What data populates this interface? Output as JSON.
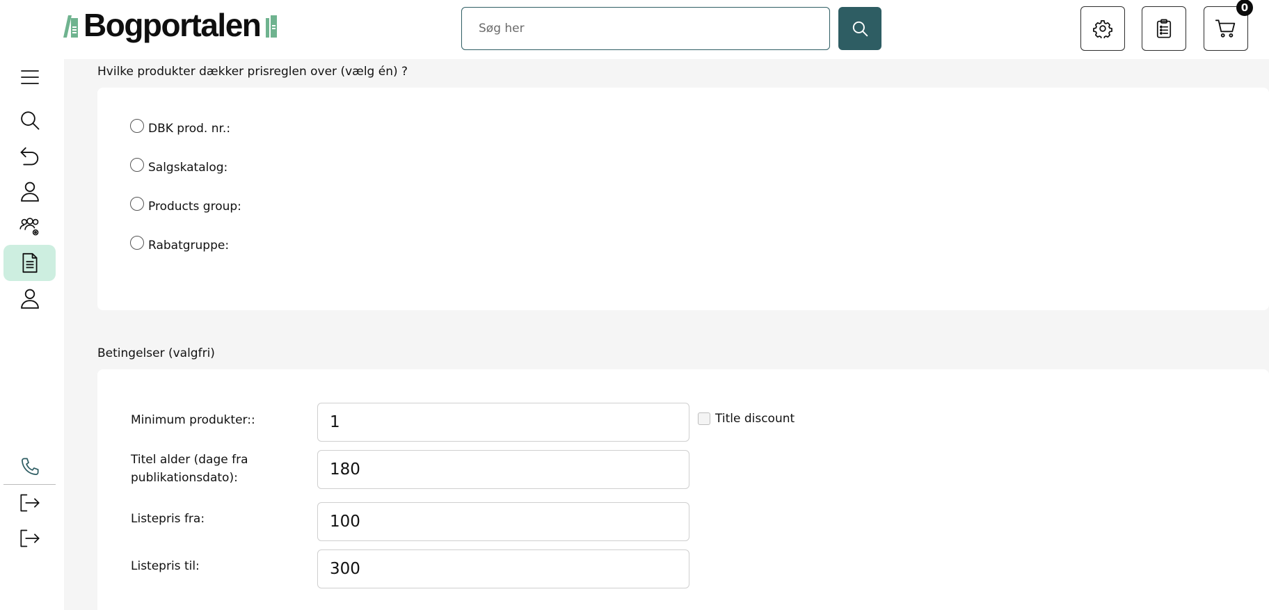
{
  "header": {
    "logo_text": "Bogportalen",
    "search_placeholder": "Søg her",
    "cart_count": "0"
  },
  "colors": {
    "brand_teal": "#2e5d63",
    "logo_green": "#6fb38f",
    "active_nav_bg": "#cdeee0",
    "main_bg": "#f5f5f5"
  },
  "sidebar": {
    "items": [
      {
        "name": "menu",
        "icon": "hamburger-icon"
      },
      {
        "name": "search",
        "icon": "search-icon"
      },
      {
        "name": "back",
        "icon": "undo-icon"
      },
      {
        "name": "user",
        "icon": "user-icon"
      },
      {
        "name": "users-settings",
        "icon": "users-gear-icon"
      },
      {
        "name": "documents",
        "icon": "document-icon",
        "active": true
      },
      {
        "name": "profile",
        "icon": "user-icon"
      },
      {
        "name": "phone",
        "icon": "phone-icon"
      },
      {
        "name": "logout-1",
        "icon": "logout-icon"
      },
      {
        "name": "logout-2",
        "icon": "logout-icon"
      }
    ]
  },
  "products_section": {
    "title": "Hvilke produkter dækker prisreglen over (vælg én) ?",
    "options": [
      {
        "label": "DBK prod. nr.:"
      },
      {
        "label": "Salgskatalog:"
      },
      {
        "label": "Products group:"
      },
      {
        "label": "Rabatgruppe:"
      }
    ]
  },
  "conditions_section": {
    "title": "Betingelser (valgfri)",
    "fields": [
      {
        "label": "Minimum produkter::",
        "value": "1"
      },
      {
        "label_line1": "Titel alder (dage fra",
        "label_line2": "publikationsdato):",
        "value": "180"
      },
      {
        "label": "Listepris fra:",
        "value": "100"
      },
      {
        "label": "Listepris til:",
        "value": "300"
      }
    ],
    "title_discount_label": "Title discount"
  }
}
